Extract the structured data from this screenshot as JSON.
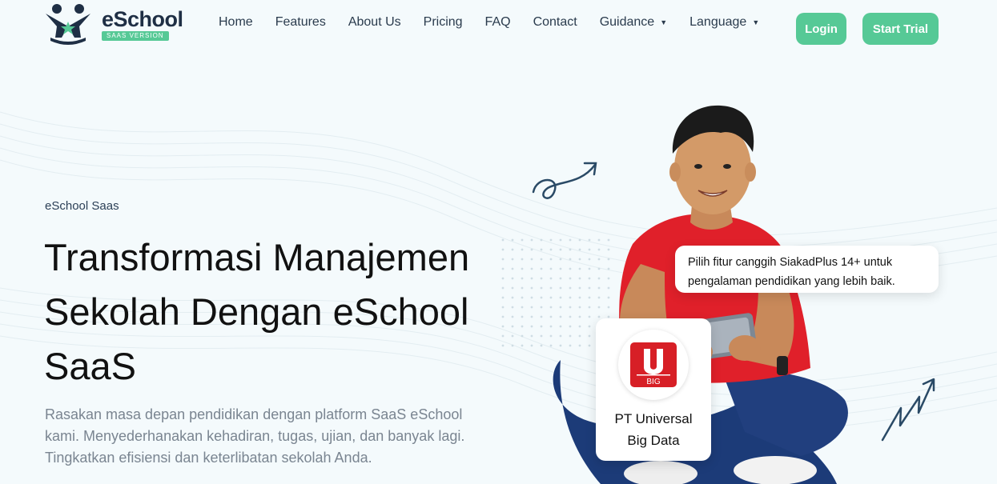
{
  "brand": {
    "name": "eSchool",
    "badge": "SAAS VERSION"
  },
  "nav": {
    "items": [
      {
        "label": "Home"
      },
      {
        "label": "Features"
      },
      {
        "label": "About Us"
      },
      {
        "label": "Pricing"
      },
      {
        "label": "FAQ"
      },
      {
        "label": "Contact"
      },
      {
        "label": "Guidance"
      },
      {
        "label": "Language"
      }
    ],
    "login_label": "Login",
    "trial_label": "Start Trial"
  },
  "hero": {
    "eyebrow": "eSchool Saas",
    "title_line1": "Transformasi Manajemen",
    "title_line2": "Sekolah Dengan eSchool",
    "title_line3": "SaaS",
    "description_line1": "Rasakan masa depan pendidikan dengan platform SaaS eSchool",
    "description_line2": "kami. Menyederhanakan kehadiran, tugas, ujian, dan banyak lagi.",
    "description_line3": "Tingkatkan efisiensi dan keterlibatan sekolah Anda."
  },
  "tooltip": {
    "line1": "Pilih fitur canggih SiakadPlus 14+ untuk",
    "line2": "pengalaman pendidikan yang lebih baik."
  },
  "company": {
    "logo_text": "BIG",
    "name_line1": "PT Universal",
    "name_line2": "Big Data"
  },
  "colors": {
    "accent": "#56c996",
    "brand_dark": "#1f2f45",
    "background": "#f4fafc",
    "shirt": "#e0202a",
    "company_red": "#d71f26"
  }
}
